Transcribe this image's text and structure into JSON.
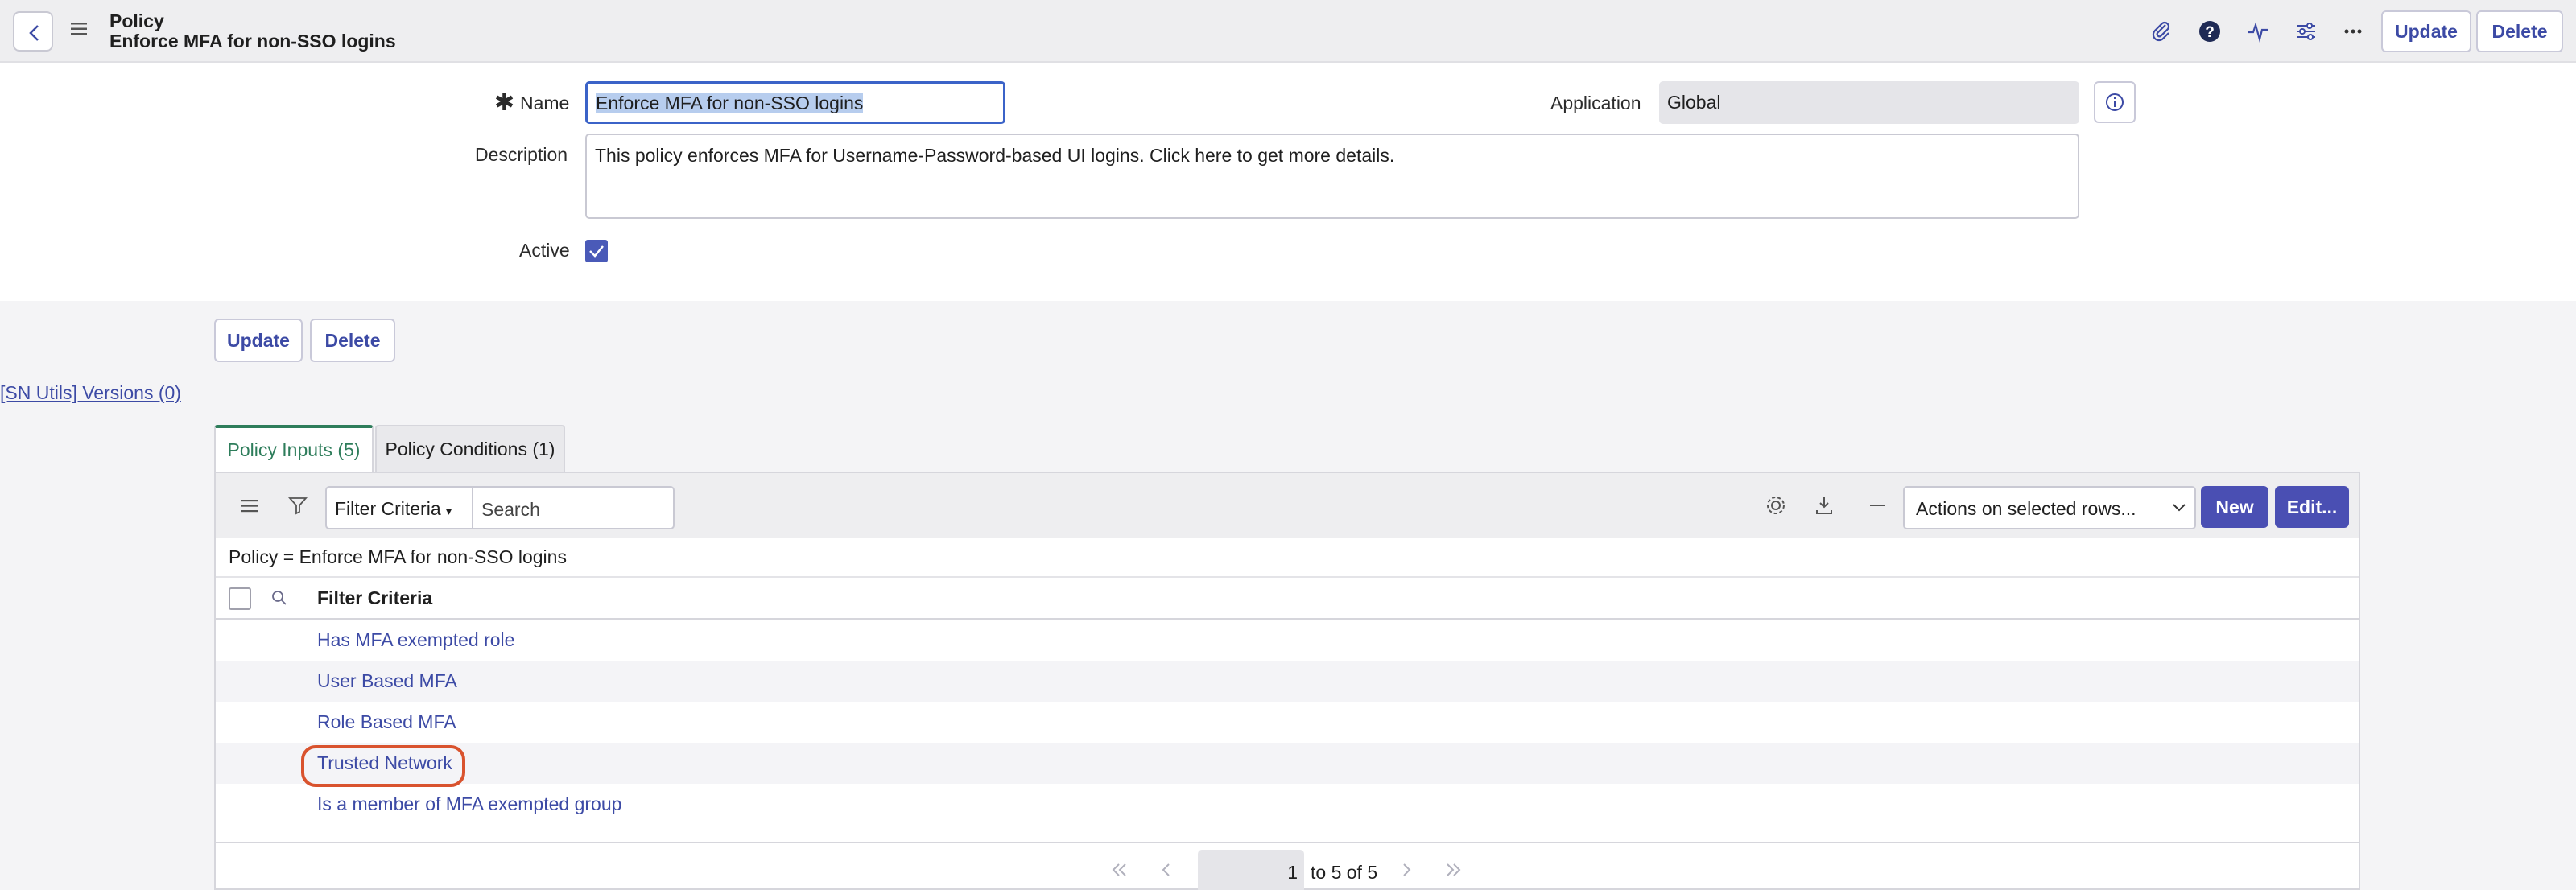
{
  "header": {
    "record_type": "Policy",
    "record_name": "Enforce MFA for non-SSO logins",
    "update_label": "Update",
    "delete_label": "Delete",
    "icons": [
      "back-chevron-icon",
      "hamburger-menu-icon",
      "paperclip-icon",
      "help-icon",
      "activity-pulse-icon",
      "settings-sliders-icon",
      "more-ellipsis-icon"
    ]
  },
  "form": {
    "name_label": "Name",
    "name_value": "Enforce MFA for non-SSO logins",
    "application_label": "Application",
    "application_value": "Global",
    "description_label": "Description",
    "description_value": "This policy enforces MFA for Username-Password-based UI logins. Click here to get more details.",
    "active_label": "Active",
    "active_checked": true,
    "update_label": "Update",
    "delete_label": "Delete"
  },
  "sn_utils_link": "[SN Utils] Versions (0)",
  "tabs": [
    {
      "label": "Policy Inputs (5)",
      "active": true
    },
    {
      "label": "Policy Conditions (1)",
      "active": false
    }
  ],
  "related_list": {
    "filter_select": "Filter Criteria",
    "search_placeholder": "Search",
    "actions_select": "Actions on selected rows...",
    "new_label": "New",
    "edit_label": "Edit...",
    "breadcrumb": "Policy = Enforce MFA for non-SSO logins",
    "column_header": "Filter Criteria",
    "rows": [
      "Has MFA exempted role",
      "User Based MFA",
      "Role Based MFA",
      "Trusted Network",
      "Is a member of MFA exempted group"
    ],
    "highlighted_row": "Trusted Network",
    "pager_value": "1",
    "pager_text": "to 5 of 5"
  },
  "colors": {
    "accent": "#4a4fb3",
    "link": "#3c4aa5",
    "active_tab": "#2e7d5b",
    "highlight_ring": "#d9532e"
  }
}
